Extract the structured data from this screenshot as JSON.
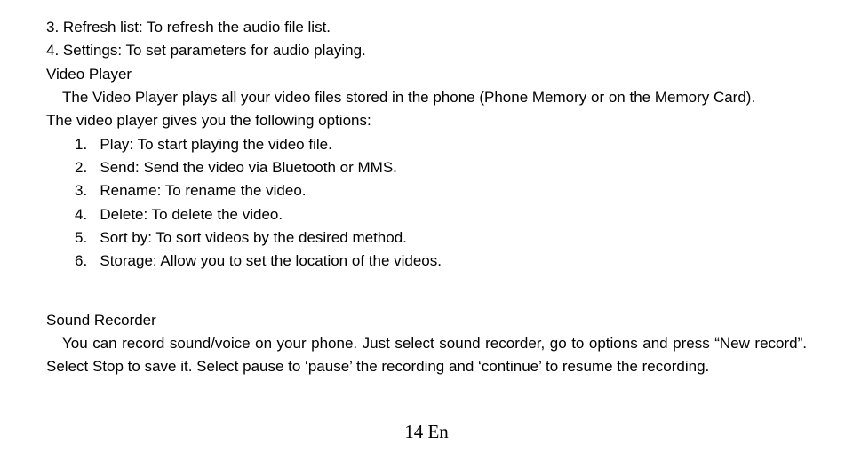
{
  "top_list": [
    {
      "num": "3.",
      "text": "Refresh list: To refresh the audio file list."
    },
    {
      "num": "4.",
      "text": "Settings: To set parameters for audio playing."
    }
  ],
  "video_player": {
    "heading": "Video Player",
    "intro_line1": "The Video Player plays all your video files stored in the phone (Phone Memory or on the Memory Card).",
    "intro_line2": "The video player gives you the following options:",
    "options": [
      {
        "num": "1.",
        "text": "Play: To start playing the video file."
      },
      {
        "num": "2.",
        "text": "Send: Send the video via Bluetooth or MMS."
      },
      {
        "num": "3.",
        "text": "Rename: To rename the video."
      },
      {
        "num": "4.",
        "text": "Delete: To delete the video."
      },
      {
        "num": "5.",
        "text": "Sort by: To sort videos by the desired method."
      },
      {
        "num": "6.",
        "text": "Storage: Allow you to set the location of the videos."
      }
    ]
  },
  "sound_recorder": {
    "heading": "Sound Recorder",
    "body": "You can record sound/voice on your phone. Just select sound recorder, go to options and press “New record”. Select Stop to save it. Select pause to ‘pause’ the recording and ‘continue’ to resume the recording."
  },
  "page_number": "14 En"
}
